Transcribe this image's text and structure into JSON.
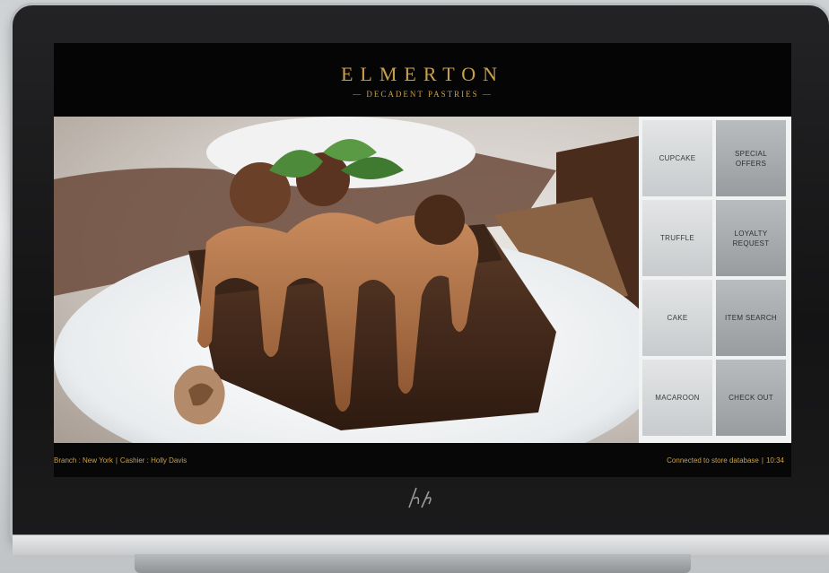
{
  "header": {
    "brand_name": "ELMERTON",
    "brand_subtitle": "— DECADENT PASTRIES —"
  },
  "hero": {
    "subject": "chocolate-cake-photo"
  },
  "buttons": [
    {
      "label": "CUPCAKE"
    },
    {
      "label": "SPECIAL OFFERS"
    },
    {
      "label": "TRUFFLE"
    },
    {
      "label": "LOYALTY REQUEST"
    },
    {
      "label": "CAKE"
    },
    {
      "label": "ITEM SEARCH"
    },
    {
      "label": "MACAROON"
    },
    {
      "label": "CHECK OUT"
    }
  ],
  "status": {
    "branch": "Branch : New York",
    "separator": "|",
    "cashier": "Cashier : Holly Davis",
    "connection": "Connected to store database",
    "time": "10:34"
  },
  "device": {
    "logo": "hp-logo",
    "accent_color": "#caa14a",
    "bezel_color": "#1a1a1b"
  }
}
